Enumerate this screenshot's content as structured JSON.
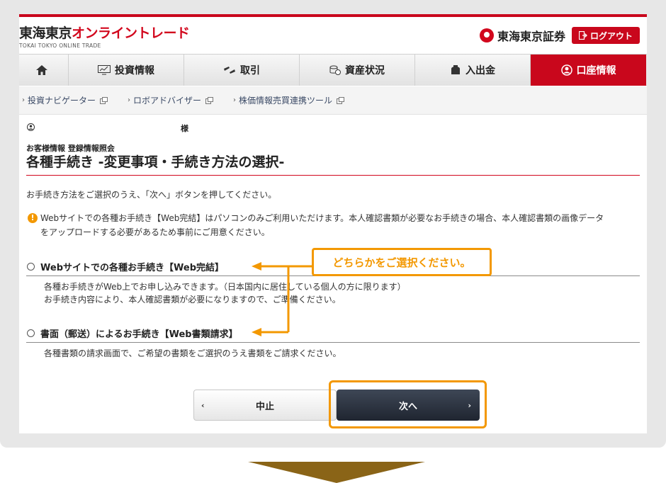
{
  "header": {
    "logo_kanji": "東海東京",
    "logo_kana": "オンライントレード",
    "logo_sub": "TOKAI TOKYO ONLINE TRADE",
    "brand_name": "東海東京証券",
    "logout_label": "ログアウト"
  },
  "nav": {
    "items": [
      {
        "label": "投資情報"
      },
      {
        "label": "取引"
      },
      {
        "label": "資産状況"
      },
      {
        "label": "入出金"
      },
      {
        "label": "口座情報"
      }
    ]
  },
  "subnav": {
    "items": [
      {
        "label": "投資ナビゲーター"
      },
      {
        "label": "ロボアドバイザー"
      },
      {
        "label": "株価情報売買連携ツール"
      }
    ]
  },
  "user": {
    "suffix": "様"
  },
  "main": {
    "breadcrumb": "お客様情報 登録情報照会",
    "title": "各種手続き -変更事項・手続き方法の選択-",
    "instruction": "お手続き方法をご選択のうえ、「次へ」ボタンを押してください。",
    "notice_icon": "!",
    "notice_line1": "Webサイトでの各種お手続き【Web完結】はパソコンのみご利用いただけます。本人確認書類が必要なお手続きの場合、本人確認書類の画像データ",
    "notice_line2": "をアップロードする必要があるため事前にご用意ください。",
    "options": [
      {
        "label": "Webサイトでの各種お手続き【Web完結】",
        "desc1": "各種お手続きがWeb上でお申し込みできます。（日本国内に居住している個人の方に限ります）",
        "desc2": "お手続き内容により、本人確認書類が必要になりますので、ご準備ください。"
      },
      {
        "label": "書面（郵送）によるお手続き【Web書類請求】",
        "desc1": "各種書類の請求画面で、ご希望の書類をご選択のうえ書類をご請求ください。"
      }
    ],
    "callout": "どちらかをご選択ください。",
    "cancel_label": "中止",
    "next_label": "次へ"
  },
  "colors": {
    "brand_red": "#c9071c",
    "accent_orange": "#f39800",
    "next_button": "#2a313d",
    "down_arrow": "#8a6417"
  },
  "icons": {
    "home": "home-icon",
    "chart": "chart-icon",
    "trade": "trade-icon",
    "assets": "coins-icon",
    "deposit": "wallet-icon",
    "account": "user-circle-icon",
    "external": "external-window-icon",
    "notice": "exclamation-icon"
  }
}
